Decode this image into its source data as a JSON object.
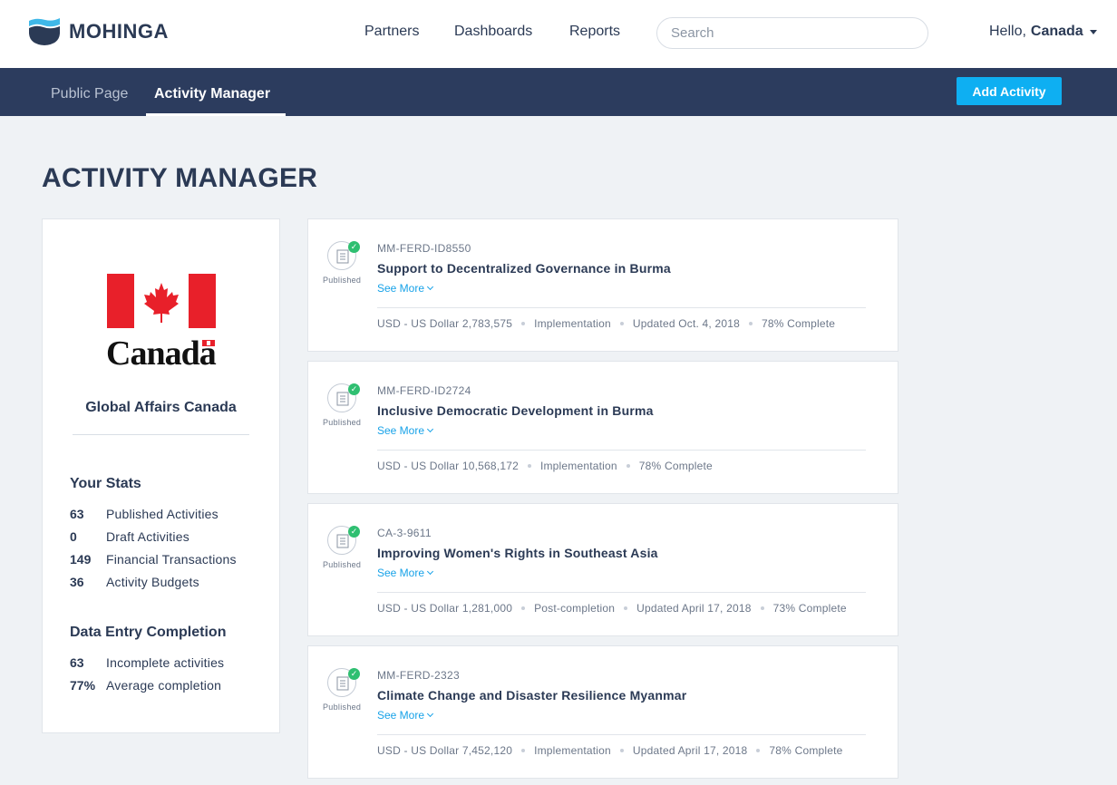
{
  "header": {
    "logo_text": "MOHINGA",
    "nav": [
      "Partners",
      "Dashboards",
      "Reports"
    ],
    "search_placeholder": "Search",
    "greeting": "Hello,",
    "user_name": "Canada"
  },
  "subnav": {
    "tabs": [
      "Public Page",
      "Activity Manager"
    ],
    "active_tab": "Activity Manager",
    "add_button": "Add Activity"
  },
  "page_title": "ACTIVITY MANAGER",
  "profile": {
    "wordmark": "Canada",
    "org_name": "Global Affairs Canada",
    "stats_heading": "Your Stats",
    "stats": [
      {
        "num": "63",
        "label": "Published Activities"
      },
      {
        "num": "0",
        "label": "Draft Activities"
      },
      {
        "num": "149",
        "label": "Financial Transactions"
      },
      {
        "num": "36",
        "label": "Activity Budgets"
      }
    ],
    "completion_heading": "Data Entry Completion",
    "completion": [
      {
        "num": "63",
        "label": "Incomplete activities"
      },
      {
        "num": "77%",
        "label": "Average completion"
      }
    ]
  },
  "activities": [
    {
      "status": "Published",
      "id": "MM-FERD-ID8550",
      "title": "Support to Decentralized Governance in Burma",
      "see_more": "See More",
      "meta": [
        "USD - US Dollar 2,783,575",
        "Implementation",
        "Updated Oct. 4, 2018",
        "78% Complete"
      ]
    },
    {
      "status": "Published",
      "id": "MM-FERD-ID2724",
      "title": "Inclusive Democratic Development in Burma",
      "see_more": "See More",
      "meta": [
        "USD - US Dollar 10,568,172",
        "Implementation",
        "78% Complete"
      ]
    },
    {
      "status": "Published",
      "id": "CA-3-9611",
      "title": "Improving Women's Rights in Southeast Asia",
      "see_more": "See More",
      "meta": [
        "USD - US Dollar 1,281,000",
        "Post-completion",
        "Updated April 17, 2018",
        "73% Complete"
      ]
    },
    {
      "status": "Published",
      "id": "MM-FERD-2323",
      "title": "Climate Change and Disaster Resilience Myanmar",
      "see_more": "See More",
      "meta": [
        "USD - US Dollar 7,452,120",
        "Implementation",
        "Updated April 17, 2018",
        "78% Complete"
      ]
    }
  ],
  "colors": {
    "navy": "#2c3c5e",
    "accent": "#0eaff2",
    "published_check": "#2fbf71",
    "canada_red": "#e8202a"
  }
}
